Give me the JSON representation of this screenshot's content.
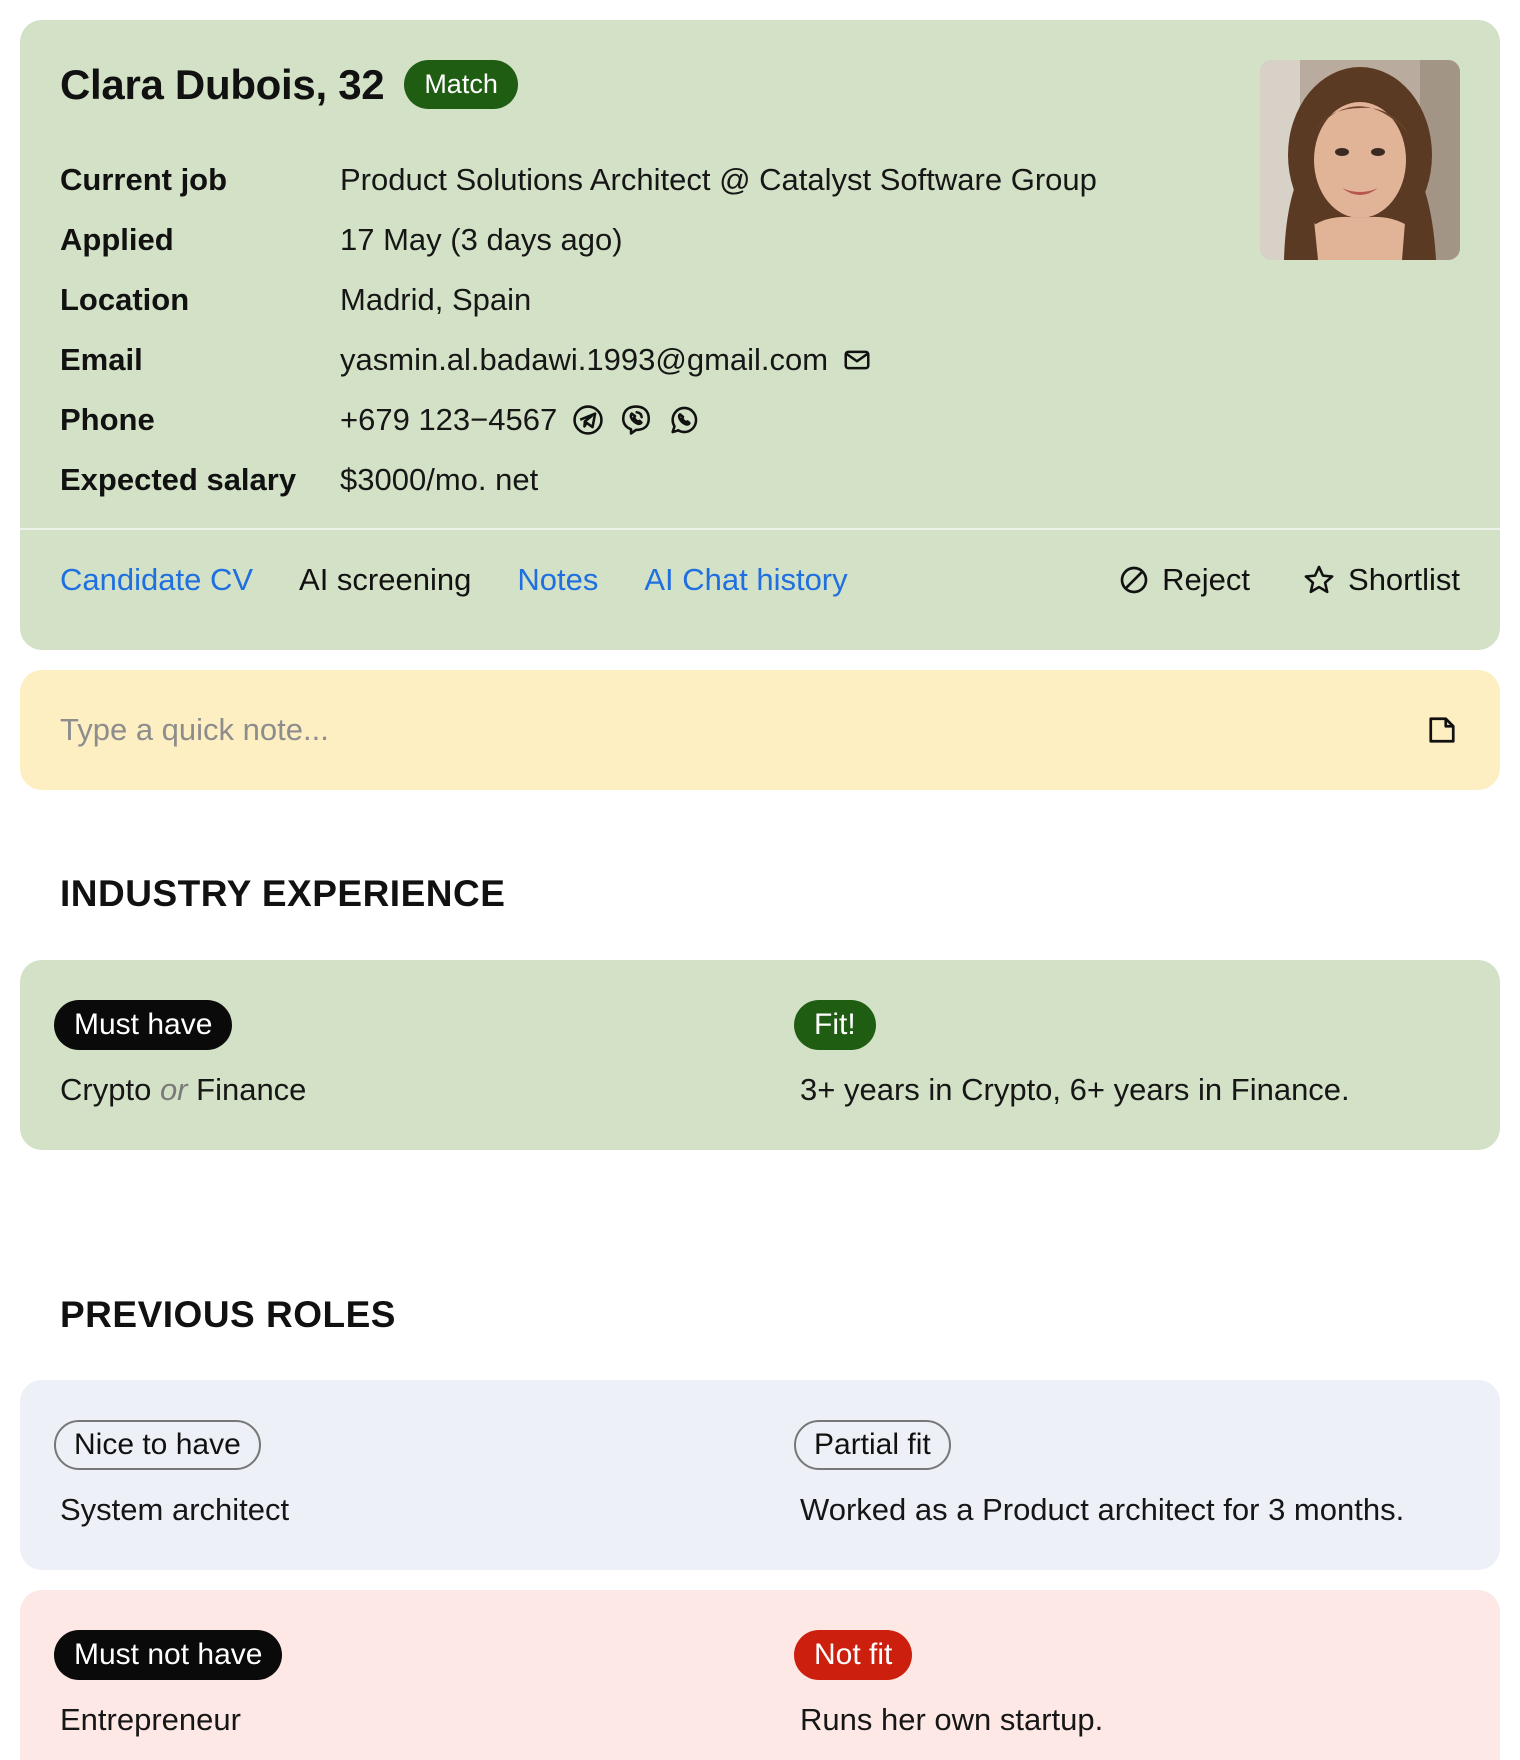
{
  "candidate": {
    "name": "Clara Dubois, 32",
    "badge": "Match"
  },
  "details": [
    {
      "label": "Current job",
      "value": "Product Solutions Architect @ Catalyst Software Group"
    },
    {
      "label": "Applied",
      "value": "17 May (3 days ago)"
    },
    {
      "label": "Location",
      "value": "Madrid, Spain"
    },
    {
      "label": "Email",
      "value": "yasmin.al.badawi.1993@gmail.com",
      "icon": "mail-icon"
    },
    {
      "label": "Phone",
      "value": "+679 123−4567",
      "icons": [
        "telegram-icon",
        "viber-icon",
        "whatsapp-icon"
      ]
    },
    {
      "label": "Expected salary",
      "value": "$3000/mo. net"
    }
  ],
  "tabs": [
    {
      "label": "Candidate CV",
      "active": false
    },
    {
      "label": "AI screening",
      "active": true
    },
    {
      "label": "Notes",
      "active": false
    },
    {
      "label": "AI Chat history",
      "active": false
    }
  ],
  "actions": {
    "reject": {
      "label": "Reject",
      "icon": "ban-icon"
    },
    "shortlist": {
      "label": "Shortlist",
      "icon": "star-icon"
    }
  },
  "note": {
    "placeholder": "Type a quick note...",
    "icon": "note-icon"
  },
  "sections": {
    "industry": {
      "title": "INDUSTRY EXPERIENCE",
      "items": [
        {
          "requirement_tag": "Must have",
          "requirement_parts": [
            "Crypto",
            "or",
            "Finance"
          ],
          "verdict_tag": "Fit!",
          "verdict_text": "3+ years in Crypto, 6+ years in Finance."
        }
      ]
    },
    "roles": {
      "title": "PREVIOUS ROLES",
      "items": [
        {
          "requirement_tag": "Nice to have",
          "requirement_text": "System architect",
          "verdict_tag": "Partial fit",
          "verdict_text": "Worked as a Product architect for 3 months."
        },
        {
          "requirement_tag": "Must not have",
          "requirement_text": "Entrepreneur",
          "verdict_tag": "Not fit",
          "verdict_text": "Runs her own startup."
        }
      ]
    }
  },
  "colors": {
    "match_green": "#1f5d12",
    "link_blue": "#1f6fe0",
    "fit_card": "#d3e2c6",
    "partial_card": "#edf0f7",
    "notfit_card": "#fde8e6",
    "notfit_red": "#cc1f0e",
    "note_card": "#fdefc2"
  }
}
